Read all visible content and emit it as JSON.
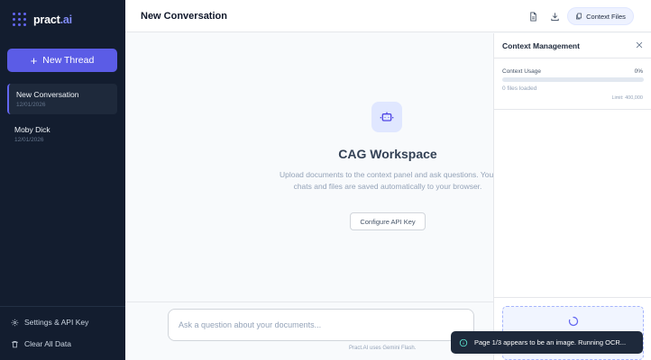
{
  "brand": {
    "name_main": "pract",
    "name_accent": ".ai"
  },
  "sidebar": {
    "new_thread_label": "New Thread",
    "threads": [
      {
        "title": "New Conversation",
        "date": "12/01/2026",
        "active": true
      },
      {
        "title": "Moby Dick",
        "date": "12/01/2026",
        "active": false
      }
    ],
    "settings_label": "Settings & API Key",
    "clear_label": "Clear All Data"
  },
  "header": {
    "title": "New Conversation",
    "context_files_label": "Context Files"
  },
  "workspace": {
    "title": "CAG Workspace",
    "description": "Upload documents to the context panel and ask questions. Your chats and files are saved automatically to your browser.",
    "configure_label": "Configure API Key"
  },
  "composer": {
    "placeholder": "Ask a question about your documents...",
    "value": "",
    "footnote": "Pract.AI uses Gemini Flash."
  },
  "context_panel": {
    "title": "Context Management",
    "usage_label": "Context Usage",
    "usage_percent": "0%",
    "usage_fraction": 0,
    "files_loaded": "0 files loaded",
    "limit": "Limit: 400,000"
  },
  "toast": {
    "message": "Page 1/3 appears to be an image. Running OCR..."
  },
  "colors": {
    "accent": "#6366f1",
    "sidebar_bg": "#131d2f",
    "toast_bg": "#1e293b"
  },
  "icons": {
    "logo": "dots-grid-icon",
    "document": "document-icon",
    "download": "download-icon",
    "context_files": "files-icon",
    "bot": "bot-icon",
    "settings": "gear-icon",
    "trash": "trash-icon",
    "close": "close-icon",
    "info": "info-icon",
    "spinner": "spinner-icon"
  }
}
